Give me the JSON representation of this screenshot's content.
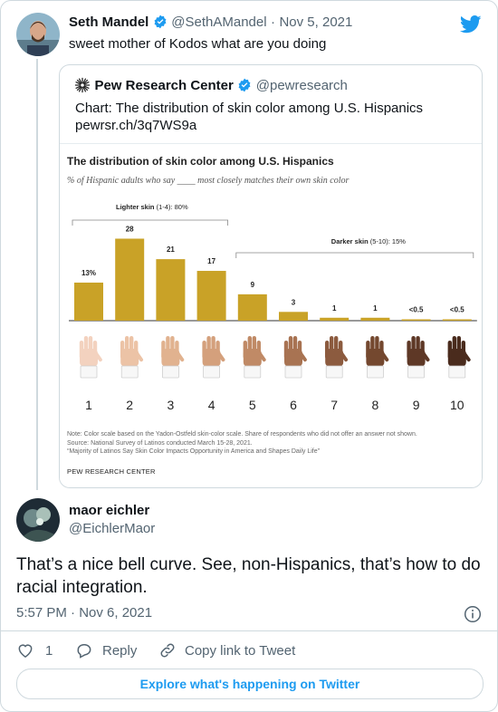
{
  "tweet1": {
    "name": "Seth Mandel",
    "handle": "@SethAMandel",
    "separator": "·",
    "date": "Nov 5, 2021",
    "text": "sweet mother of Kodos what are you doing"
  },
  "quote": {
    "name": "Pew Research Center",
    "handle": "@pewresearch",
    "text": "Chart: The distribution of skin color among U.S. Hispanics",
    "link": "pewrsr.ch/3q7WS9a"
  },
  "chart_data": {
    "type": "bar",
    "title": "The distribution of skin color among U.S. Hispanics",
    "subtitle": "% of Hispanic adults who say ____ most closely matches their own skin color",
    "categories": [
      "1",
      "2",
      "3",
      "4",
      "5",
      "6",
      "7",
      "8",
      "9",
      "10"
    ],
    "values": [
      13,
      28,
      21,
      17,
      9,
      3,
      1,
      1,
      0.3,
      0.3
    ],
    "value_labels": [
      "13%",
      "28",
      "21",
      "17",
      "9",
      "3",
      "1",
      "1",
      "<0.5",
      "<0.5"
    ],
    "groups": [
      {
        "label_bold": "Lighter skin",
        "label_rest": " (1-4): 80%",
        "from": 1,
        "to": 4
      },
      {
        "label_bold": "Darker skin",
        "label_rest": " (5-10): 15%",
        "from": 5,
        "to": 10
      }
    ],
    "skin_tones": [
      "#f3d2bf",
      "#ecc3a6",
      "#e1b28f",
      "#d4a07c",
      "#c08a66",
      "#a87352",
      "#8c5b3f",
      "#74482f",
      "#5e3826",
      "#4a2b1d"
    ],
    "bar_color": "#c9a227",
    "ylim": [
      0,
      30
    ],
    "notes": [
      "Note: Color scale based on the Yadon-Ostfeld skin-color scale. Share of respondents who did not offer an answer not shown.",
      "Source: National Survey of Latinos conducted March 15-28, 2021.",
      "“Majority of Latinos Say Skin Color Impacts Opportunity in America and Shapes Daily Life”"
    ],
    "source_org": "PEW RESEARCH CENTER"
  },
  "tweet2": {
    "name": "maor eichler",
    "handle": "@EichlerMaor",
    "text": "That’s a nice bell curve. See, non-Hispanics, that’s how to do racial integration.",
    "timestamp": "5:57 PM · Nov 6, 2021"
  },
  "actions": {
    "like_count": "1",
    "reply_label": "Reply",
    "copy_label": "Copy link to Tweet"
  },
  "explore_label": "Explore what's happening on Twitter",
  "colors": {
    "accent": "#1d9bf0",
    "muted": "#536471",
    "border": "#cfd9de"
  }
}
